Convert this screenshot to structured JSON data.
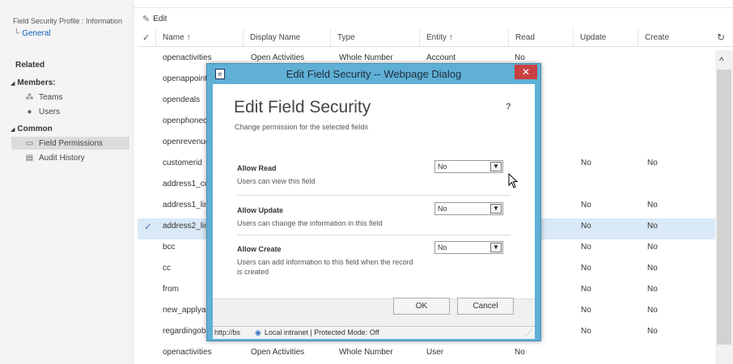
{
  "nav": {
    "breadcrumb": "Field Security Profile : Information",
    "general": "General",
    "related": "Related",
    "members": "Members:",
    "teams": "Teams",
    "users": "Users",
    "common": "Common",
    "field_permissions": "Field Permissions",
    "audit_history": "Audit History"
  },
  "toolbar": {
    "edit": "Edit"
  },
  "grid": {
    "headers": {
      "name": "Name ↑",
      "display_name": "Display Name",
      "type": "Type",
      "entity": "Entity ↑",
      "read": "Read",
      "update": "Update",
      "create": "Create"
    },
    "rows": [
      {
        "name": "openactivities",
        "display": "Open Activities",
        "type": "Whole Number",
        "entity": "Account",
        "read": "No",
        "update": "",
        "create": ""
      },
      {
        "name": "openappoint",
        "display": "",
        "type": "",
        "entity": "",
        "read": "",
        "update": "",
        "create": ""
      },
      {
        "name": "opendeals",
        "display": "",
        "type": "",
        "entity": "",
        "read": "",
        "update": "",
        "create": ""
      },
      {
        "name": "openphonec",
        "display": "",
        "type": "",
        "entity": "",
        "read": "",
        "update": "",
        "create": ""
      },
      {
        "name": "openrevenue",
        "display": "",
        "type": "",
        "entity": "",
        "read": "",
        "update": "",
        "create": ""
      },
      {
        "name": "customerid",
        "display": "",
        "type": "",
        "entity": "",
        "read": "",
        "update": "No",
        "create": "No"
      },
      {
        "name": "address1_co",
        "display": "",
        "type": "",
        "entity": "",
        "read": "",
        "update": "",
        "create": ""
      },
      {
        "name": "address1_lin",
        "display": "",
        "type": "",
        "entity": "",
        "read": "",
        "update": "No",
        "create": "No"
      },
      {
        "name": "address2_lin",
        "display": "",
        "type": "",
        "entity": "",
        "read": "",
        "update": "No",
        "create": "No",
        "selected": true
      },
      {
        "name": "bcc",
        "display": "",
        "type": "",
        "entity": "",
        "read": "",
        "update": "No",
        "create": "No"
      },
      {
        "name": "cc",
        "display": "",
        "type": "",
        "entity": "",
        "read": "",
        "update": "No",
        "create": "No"
      },
      {
        "name": "from",
        "display": "",
        "type": "",
        "entity": "",
        "read": "",
        "update": "No",
        "create": "No"
      },
      {
        "name": "new_applyac",
        "display": "",
        "type": "",
        "entity": "",
        "read": "",
        "update": "No",
        "create": "No"
      },
      {
        "name": "regardingob",
        "display": "",
        "type": "",
        "entity": "",
        "read": "",
        "update": "No",
        "create": "No"
      },
      {
        "name": "openactivities",
        "display": "Open Activities",
        "type": "Whole Number",
        "entity": "User",
        "read": "No",
        "update": "",
        "create": ""
      }
    ]
  },
  "dialog": {
    "window_title": "Edit Field Security -- Webpage Dialog",
    "close_symbol": "✕",
    "heading": "Edit Field Security",
    "subheading": "Change permission for the selected fields",
    "help": "?",
    "allow_read": {
      "label": "Allow Read",
      "desc": "Users can view this field",
      "value": "No"
    },
    "allow_update": {
      "label": "Allow Update",
      "desc": "Users can change the information in this field",
      "value": "No"
    },
    "allow_create": {
      "label": "Allow Create",
      "desc": "Users can add information to this field when the record is created",
      "value": "No"
    },
    "ok": "OK",
    "cancel": "Cancel",
    "status_url": "http://bs",
    "status_zone": "Local intranet | Protected Mode: Off"
  },
  "colors": {
    "titlebar": "#60b0d6",
    "close": "#c94040",
    "selected_row": "#d9e9f7"
  }
}
